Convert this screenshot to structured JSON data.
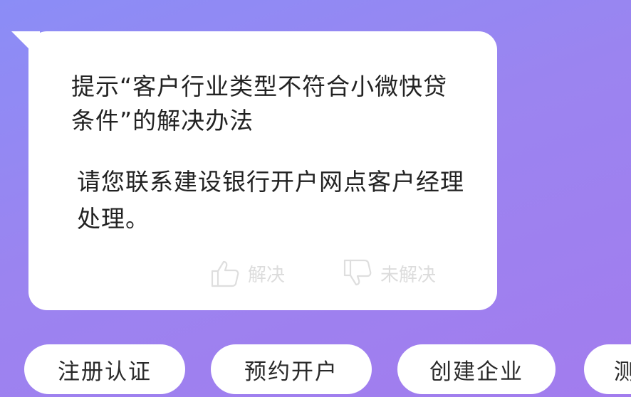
{
  "message": {
    "question": "提示“客户行业类型不符合小微快贷条件”的解决办法",
    "answer": "请您联系建设银行开户网点客户经理处理。",
    "feedback": {
      "resolved_label": "解决",
      "unresolved_label": "未解决",
      "resolved_icon": "thumbs-up-icon",
      "unresolved_icon": "thumbs-down-icon"
    }
  },
  "quick_actions": [
    {
      "label": "注册认证"
    },
    {
      "label": "预约开户"
    },
    {
      "label": "创建企业"
    },
    {
      "label": "测"
    }
  ],
  "colors": {
    "background_start": "#8b8df6",
    "background_end": "#a27cee",
    "bubble": "#ffffff",
    "feedback_text": "#dcdcdc"
  }
}
